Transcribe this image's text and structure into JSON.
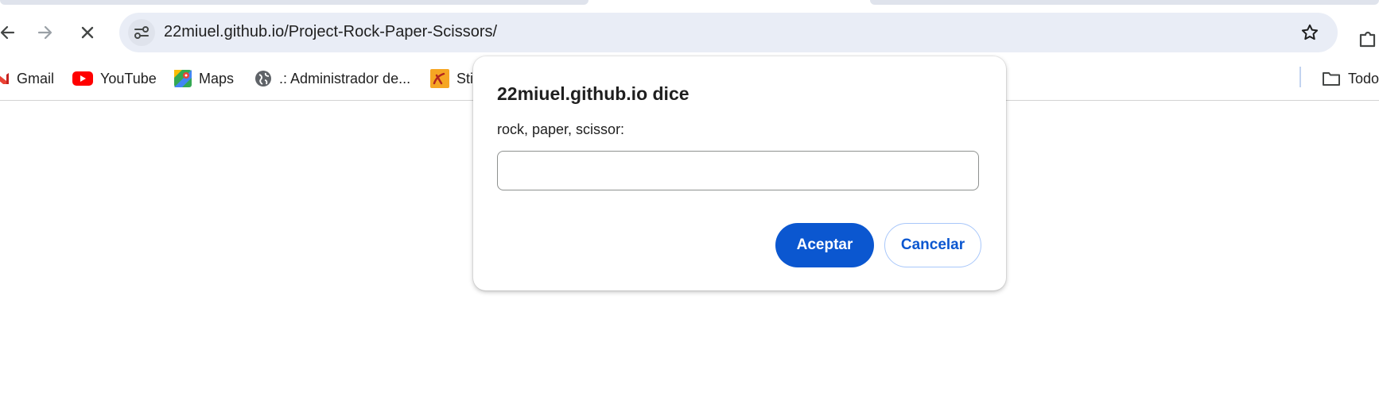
{
  "browser": {
    "url": "22miuel.github.io/Project-Rock-Paper-Scissors/",
    "nav": {
      "back_icon": "arrow-left-icon",
      "forward_icon": "arrow-right-icon",
      "stop_icon": "close-icon"
    },
    "bookmarks": [
      {
        "label": "Gmail",
        "icon": "gmail-icon"
      },
      {
        "label": "YouTube",
        "icon": "youtube-icon"
      },
      {
        "label": "Maps",
        "icon": "maps-icon"
      },
      {
        "label": ".: Administrador de...",
        "icon": "globe-icon"
      },
      {
        "label": "Sti",
        "icon": "site-favicon-icon"
      }
    ],
    "all_bookmarks_label": "Todo"
  },
  "dialog": {
    "title": "22miuel.github.io dice",
    "message": "rock, paper, scissor:",
    "input_value": "",
    "ok_label": "Aceptar",
    "cancel_label": "Cancelar"
  },
  "colors": {
    "accent": "#0b57d0",
    "omnibox_bg": "#e9edf6"
  }
}
